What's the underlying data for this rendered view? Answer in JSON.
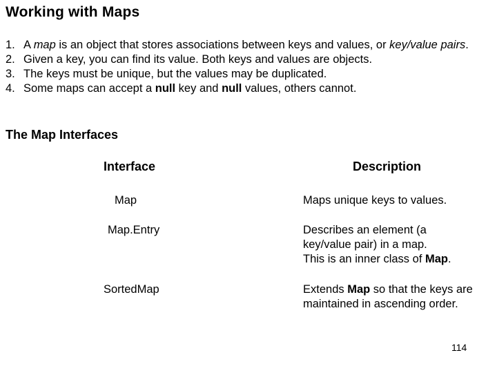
{
  "slide": {
    "title": "Working with Maps",
    "page_number": "114"
  },
  "list": [
    {
      "num": "1.",
      "pre": "A ",
      "em": "map",
      "post": " is an object that stores associations between keys and values, or ",
      "em2": "key/value pairs",
      "end": "."
    },
    {
      "num": "2.",
      "text": "Given a key, you can find its value. Both keys and values are objects."
    },
    {
      "num": "3.",
      "text": "The keys must be unique, but the values may be duplicated."
    },
    {
      "num": "4.",
      "pre": "Some maps can accept a ",
      "b1": "null",
      "mid": " key and ",
      "b2": "null",
      "post": " values, others cannot."
    }
  ],
  "section_heading": "The Map Interfaces",
  "table": {
    "headers": {
      "interface": "Interface",
      "description": "Description"
    },
    "rows": [
      {
        "interface": "Map",
        "description": "Maps unique keys to values."
      },
      {
        "interface": "Map.Entry",
        "desc_line1": "Describes an element (a",
        "desc_line2": "key/value pair) in a map.",
        "desc_line3_pre": "This is an inner class of ",
        "desc_line3_bold": "Map",
        "desc_line3_end": "."
      },
      {
        "interface": "SortedMap",
        "desc_pre": "Extends ",
        "desc_bold": "Map",
        "desc_post": " so that the keys are",
        "desc_line2": "maintained in ascending order."
      }
    ]
  }
}
